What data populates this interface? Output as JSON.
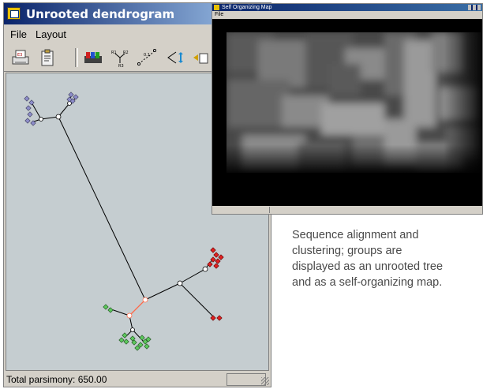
{
  "main_window": {
    "title": "Unrooted dendrogram",
    "menu": [
      "File",
      "Layout"
    ],
    "toolbar_icons": [
      "print-icon",
      "clipboard-icon",
      "color-tree-icon",
      "tree-style-icon",
      "branch-length-icon",
      "expand-icon",
      "layout-icon"
    ],
    "toolbar_icon_text": {
      "tree_style": [
        "R1",
        "R2",
        "R3"
      ],
      "branch_length": "0.1"
    },
    "status": "Total parsimony: 650.00"
  },
  "som_window": {
    "title": "Self Organizing Map",
    "menu": [
      "File"
    ]
  },
  "caption": [
    "Sequence alignment and",
    "clustering; groups are",
    "displayed as an unrooted tree",
    "and as a self-organizing map."
  ],
  "colors": {
    "cluster_blue": "#8c8cc8",
    "cluster_red": "#e02020",
    "cluster_green": "#5cc85c",
    "highlight_branch": "#ff6a4a"
  }
}
